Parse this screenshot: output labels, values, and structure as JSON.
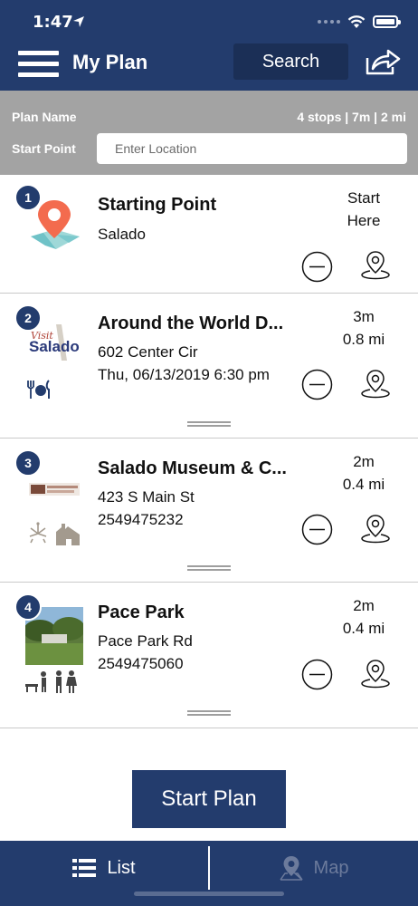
{
  "status": {
    "time": "1:47"
  },
  "header": {
    "title": "My Plan",
    "search_label": "Search"
  },
  "plan": {
    "name_label": "Plan Name",
    "stats": "4 stops | 7m | 2 mi",
    "start_label": "Start Point",
    "start_placeholder": "Enter Location"
  },
  "stops": [
    {
      "number": "1",
      "name": "Starting Point",
      "line1": "Salado",
      "line2": "",
      "meta1": "Start",
      "meta2": "Here"
    },
    {
      "number": "2",
      "name": "Around the World D...",
      "line1": "602 Center Cir",
      "line2": "Thu, 06/13/2019 6:30 pm",
      "meta1": "3m",
      "meta2": "0.8 mi",
      "logo_text_small": "Visit",
      "logo_text": "Salado"
    },
    {
      "number": "3",
      "name": "Salado Museum & C...",
      "line1": "423 S Main St",
      "line2": "2549475232",
      "meta1": "2m",
      "meta2": "0.4 mi"
    },
    {
      "number": "4",
      "name": "Pace Park",
      "line1": "Pace Park Rd",
      "line2": "2549475060",
      "meta1": "2m",
      "meta2": "0.4 mi"
    }
  ],
  "actions": {
    "start_plan_label": "Start Plan"
  },
  "tabs": {
    "list_label": "List",
    "map_label": "Map"
  },
  "colors": {
    "primary": "#233c6d",
    "gray_bar": "#a3a3a3",
    "pin_orange": "#f36b4e"
  }
}
